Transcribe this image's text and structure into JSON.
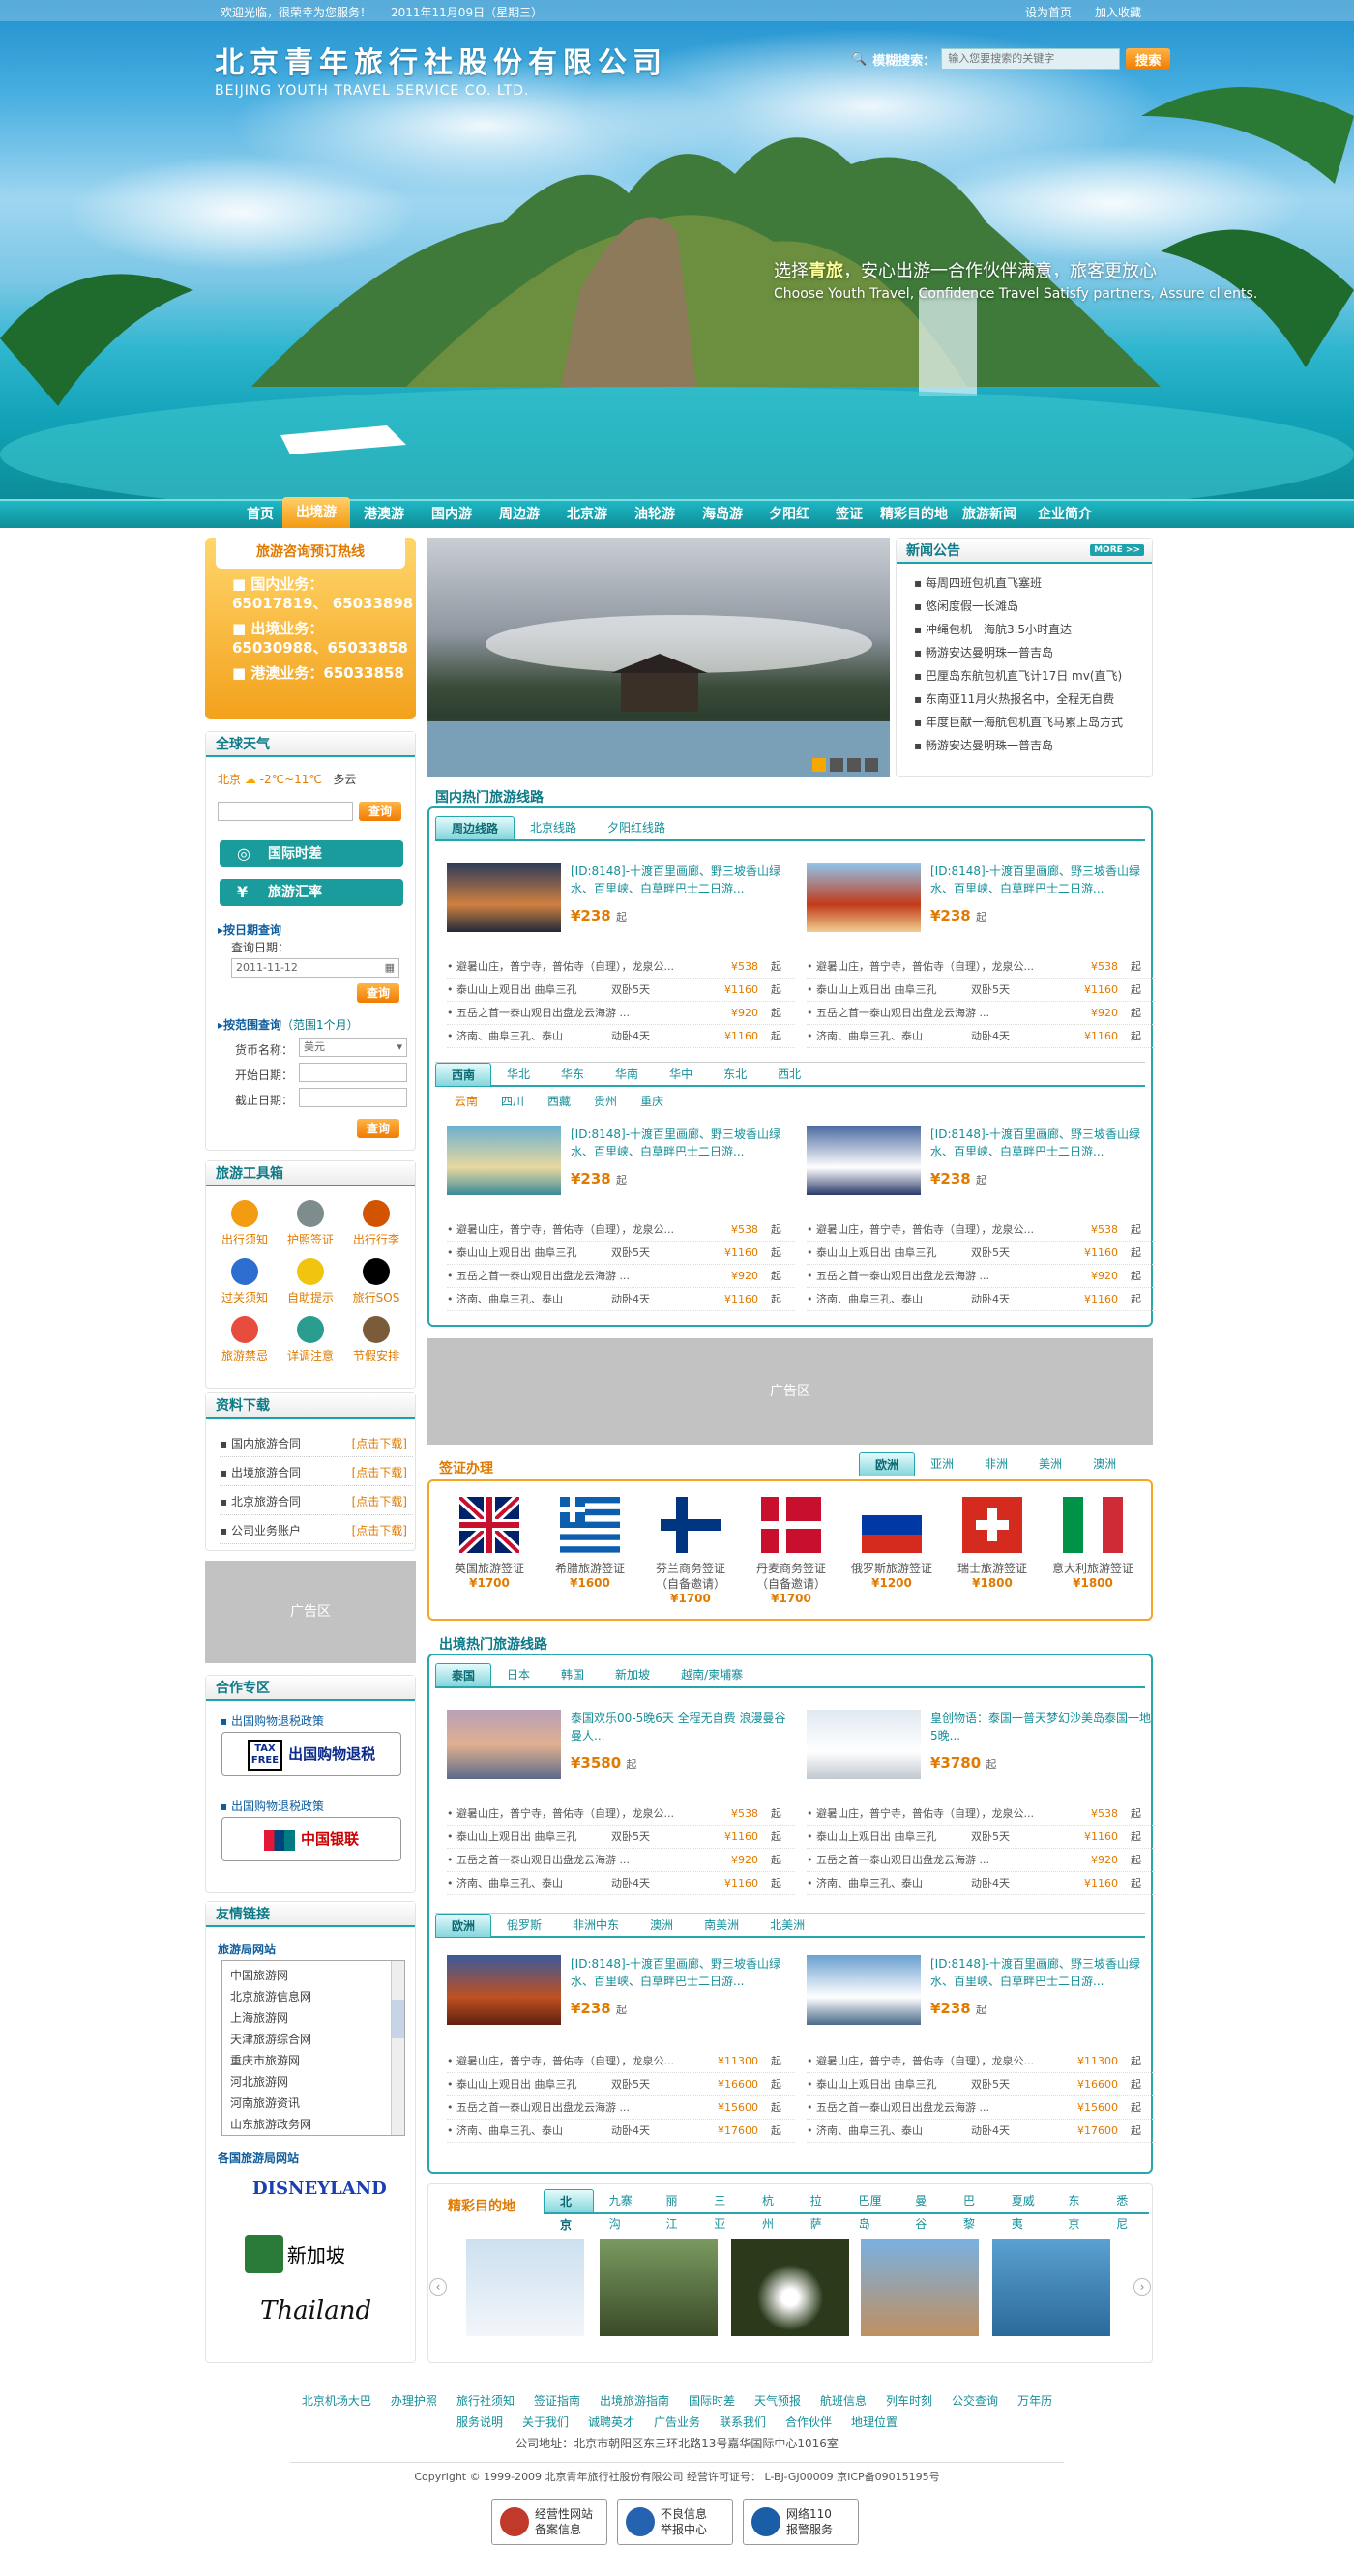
{
  "topbar": {
    "greeting": "欢迎光临，很荣幸为您服务！",
    "date": "2011年11月09日（星期三）",
    "set_home": "设为首页",
    "add_fav": "加入收藏"
  },
  "brand": {
    "name_cn": "北京青年旅行社股份有限公司",
    "name_en": "BEIJING YOUTH TRAVEL SERVICE CO. LTD."
  },
  "search": {
    "label": "模糊搜索：",
    "placeholder": "输入您要搜索的关键字",
    "button": "搜索"
  },
  "slogan": {
    "line1_a": "选择",
    "line1_b": "青旅",
    "line1_c": "，安心出游一合作伙伴满意，旅客更放心",
    "line2": "Choose Youth Travel, Confidence Travel Satisfy partners, Assure clients."
  },
  "nav": [
    "首页",
    "出境游",
    "港澳游",
    "国内游",
    "周边游",
    "北京游",
    "油轮游",
    "海岛游",
    "夕阳红",
    "签证",
    "精彩目的地",
    "旅游新闻",
    "企业简介"
  ],
  "hotline": {
    "title": "旅游咨询预订热线",
    "domestic_label": "国内业务：",
    "domestic_nums": "65017819、 65033898",
    "outbound_label": "出境业务：",
    "outbound_nums": "65030988、65033858",
    "hk_label": "港澳业务：",
    "hk_nums": "65033858"
  },
  "weather": {
    "title": "全球天气",
    "city": "北京",
    "temp": "-2℃~11℃",
    "cond": "多云",
    "button": "查询"
  },
  "tools_btn": {
    "timezone": "国际时差",
    "rate": "旅游汇率"
  },
  "date_query": {
    "title": "按日期查询",
    "label": "查询日期：",
    "value": "2011-11-12",
    "button": "查询"
  },
  "range_query": {
    "title": "按范围查询",
    "title_hint": "（范围1个月）",
    "currency_label": "货币名称：",
    "currency_value": "美元",
    "start_label": "开始日期：",
    "end_label": "截止日期：",
    "button": "查询"
  },
  "toolbox": {
    "title": "旅游工具箱",
    "items": [
      "出行须知",
      "护照签证",
      "出行行李",
      "过关须知",
      "自助提示",
      "旅行SOS",
      "旅游禁忌",
      "详调注意",
      "节假安排"
    ]
  },
  "downloads": {
    "title": "资料下载",
    "items": [
      {
        "name": "国内旅游合同",
        "action": "[点击下载]"
      },
      {
        "name": "出境旅游合同",
        "action": "[点击下载]"
      },
      {
        "name": "北京旅游合同",
        "action": "[点击下载]"
      },
      {
        "name": "公司业务账户",
        "action": "[点击下载]"
      }
    ]
  },
  "ad_label": "广告区",
  "coop": {
    "title": "合作专区",
    "item1": "出国购物退税政策",
    "btn1": "出国购物退税",
    "item2": "出国购物退税政策",
    "btn2": "中国银联"
  },
  "links": {
    "title": "友情链接",
    "sub1": "旅游局网站",
    "items": [
      "中国旅游网",
      "北京旅游信息网",
      "上海旅游网",
      "天津旅游综合网",
      "重庆市旅游网",
      "河北旅游网",
      "河南旅游资讯",
      "山东旅游政务网"
    ],
    "sub2": "各国旅游局网站",
    "logo1": "DISNEYLAND",
    "logo2": "新加坡",
    "logo3": "Thailand"
  },
  "news": {
    "title": "新闻公告",
    "more": "MORE >>",
    "items": [
      "每周四班包机直飞塞班",
      "悠闲度假一长滩岛",
      "冲绳包机一海航3.5小时直达",
      "畅游安达曼明珠一普吉岛",
      "巴厘岛东航包机直飞计17日 mv(直飞)",
      "东南亚11月火热报名中，全程无自费",
      "年度巨献一海航包机直飞马累上岛方式",
      "畅游安达曼明珠一普吉岛"
    ]
  },
  "domestic": {
    "title": "国内热门旅游线路",
    "tabs": [
      "周边线路",
      "北京线路",
      "夕阳红线路"
    ],
    "tabs2": [
      "西南",
      "华北",
      "华东",
      "华南",
      "华中",
      "东北",
      "西北"
    ],
    "sub2": [
      "云南",
      "四川",
      "西藏",
      "贵州",
      "重庆"
    ]
  },
  "feature": {
    "title": "[ID:8148]-十渡百里画廊、野三坡香山绿水、百里峡、白草畔巴士二日游...",
    "price": "¥238",
    "unit": "起"
  },
  "rows": [
    {
      "name": "避暑山庄，普宁寺，普佑寺（自理），龙泉公...",
      "days": "",
      "price": "¥538",
      "unit": "起"
    },
    {
      "name": "泰山山上观日出 曲阜三孔",
      "days": "双卧5天",
      "price": "¥1160",
      "unit": "起"
    },
    {
      "name": "五岳之首一泰山观日出盘龙云海游 ...",
      "days": "",
      "price": "¥920",
      "unit": "起"
    },
    {
      "name": "济南、曲阜三孔、泰山",
      "days": "动卧4天",
      "price": "¥1160",
      "unit": "起"
    }
  ],
  "ad_mid": "广告区",
  "visa": {
    "title": "签证办理",
    "tabs": [
      "欧洲",
      "亚洲",
      "非洲",
      "美洲",
      "澳洲"
    ],
    "items": [
      {
        "name": "英国旅游签证",
        "price": "¥1700"
      },
      {
        "name": "希腊旅游签证",
        "price": "¥1600"
      },
      {
        "name": "芬兰商务签证\n（自备邀请）",
        "price": "¥1700"
      },
      {
        "name": "丹麦商务签证\n（自备邀请）",
        "price": "¥1700"
      },
      {
        "name": "俄罗斯旅游签证",
        "price": "¥1200"
      },
      {
        "name": "瑞士旅游签证",
        "price": "¥1800"
      },
      {
        "name": "意大利旅游签证",
        "price": "¥1800"
      }
    ]
  },
  "outbound": {
    "title": "出境热门旅游线路",
    "tabs": [
      "泰国",
      "日本",
      "韩国",
      "新加坡",
      "越南/柬埔寨"
    ],
    "tabs2": [
      "欧洲",
      "俄罗斯",
      "非洲中东",
      "澳洲",
      "南美洲",
      "北美洲"
    ],
    "f1": {
      "title": "泰国欢乐00-5晚6天 全程无自费 浪漫曼谷 曼人...",
      "price": "¥3580",
      "unit": "起"
    },
    "f2": {
      "title": "皇创物语：泰国一普天梦幻沙美岛泰国一地5晚...",
      "price": "¥3780",
      "unit": "起"
    },
    "rows3": [
      {
        "price": "¥11300"
      },
      {
        "price": "¥16600"
      },
      {
        "price": "¥15600"
      },
      {
        "price": "¥17600"
      }
    ]
  },
  "dest": {
    "title": "精彩目的地",
    "tabs": [
      "北京",
      "九寨沟",
      "丽江",
      "三亚",
      "杭州",
      "拉萨",
      "巴厘岛",
      "曼谷",
      "巴黎",
      "夏威夷",
      "东京",
      "悉尼"
    ]
  },
  "footer": {
    "links1": [
      "北京机场大巴",
      "办理护照",
      "旅行社须知",
      "签证指南",
      "出境旅游指南",
      "国际时差",
      "天气预报",
      "航班信息",
      "列车时刻",
      "公交查询",
      "万年历"
    ],
    "links2": [
      "服务说明",
      "关于我们",
      "诚聘英才",
      "广告业务",
      "联系我们",
      "合作伙伴",
      "地理位置"
    ],
    "address": "公司地址：北京市朝阳区东三环北路13号嘉华国际中心1016室",
    "copyright": "Copyright © 1999-2009 北京青年旅行社股份有限公司 经营许可证号： L-BJ-GJ00009 京ICP备09015195号",
    "badges": [
      [
        "经营性网站",
        "备案信息"
      ],
      [
        "不良信息",
        "举报中心"
      ],
      [
        "网络110",
        "报警服务"
      ]
    ]
  }
}
